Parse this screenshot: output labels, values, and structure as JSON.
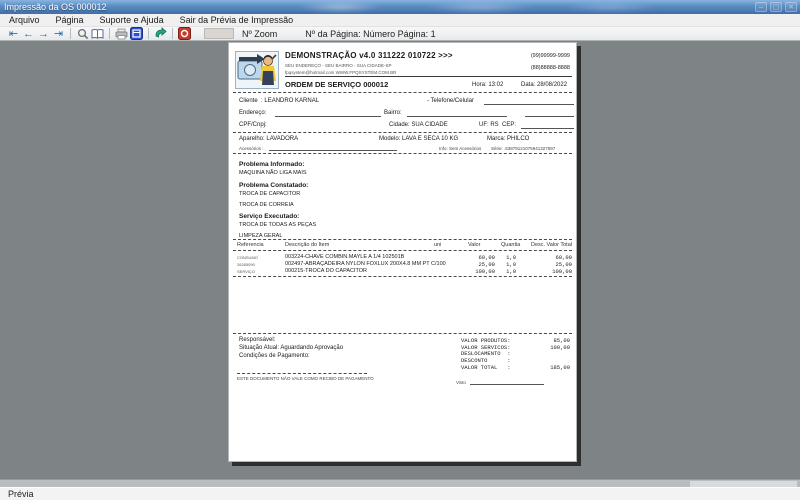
{
  "accents": {
    "titlebar_blue": "#4a7fb5",
    "workspace_gray": "#7e8486",
    "nav_arrow_blue": "#2f6bb3",
    "stop_red": "#c23b2e",
    "export_green": "#1f8a70",
    "setup_blue": "#2b4fd8"
  },
  "window": {
    "title": "Impressão da OS 000012",
    "controls": {
      "minimize": "–",
      "maximize": "▢",
      "close": "✕"
    }
  },
  "menu": {
    "items": [
      "Arquivo",
      "Página",
      "Suporte e Ajuda",
      "Sair da Prévia de Impressão"
    ]
  },
  "toolbar": {
    "nav": [
      {
        "name": "first-page",
        "glyph": "⇤"
      },
      {
        "name": "prev-page",
        "glyph": "←"
      },
      {
        "name": "next-page",
        "glyph": "→"
      },
      {
        "name": "last-page",
        "glyph": "⇥"
      }
    ],
    "icons": [
      "zoom-icon",
      "two-page-view-icon",
      "print-icon",
      "print-setup-icon",
      "export-icon",
      "close-preview-icon"
    ],
    "zoom_value": "",
    "zoom_label": "Nº Zoom",
    "page_label": "Nº da Página: Número Página: 1"
  },
  "statusbar": {
    "text": "Prévia"
  },
  "document": {
    "header": {
      "company_name": "DEMONSTRAÇÃO v4.0 311222 010722 >>>",
      "address": "SEU ENDEREÇO - SEU BAIRRO - SUA CIDADE-SP",
      "contact": "fpqsystem@hotmail.com  WWW.FPQSYSTEM.COM.BR",
      "phone1": "(99)99999-9999",
      "phone2": "(88)88888-8888",
      "order_title": "ORDEM DE SERVIÇO 000012",
      "hora": "Hora: 13:02",
      "data": "Data: 28/08/2022"
    },
    "client": {
      "cliente_label": "Cliente  :",
      "cliente": "LEANDRO KARNAL",
      "telefone_label": "- Telefone/Celular",
      "endereco_label": "Endereço:",
      "bairro_label": "Bairro:",
      "cpf_label": "CPF/Cnpj:",
      "cidade": "Cidade: SUA CIDADE",
      "uf_cep": "UF: RS  CEP:",
      "aparelho": "Aparelho: LAVADORA",
      "modelo": "Modelo: LAVA E SECA 10 KG",
      "marca": "Marca: PHILCO",
      "acessorios_label": "Acessórios :",
      "info": "Info: Sem Acessórios",
      "serie": "Série: .53879121075941327597"
    },
    "sections": [
      {
        "title": "Problema Informado:",
        "lines": [
          "MAQUINA NÃO LIGA MAIS"
        ]
      },
      {
        "title": "Problema Constatado:",
        "lines": [
          "TROCA DE CAPACITOR",
          "TROCA DE CORREIA"
        ]
      },
      {
        "title": "Serviço Executado:",
        "lines": [
          "TROCA DE TODAS AS PEÇAS",
          "LIMPEZA GERAL"
        ]
      }
    ],
    "items": {
      "headers": {
        "ref": "Referencia",
        "desc": "Descrição do Item",
        "uni": "uni",
        "valor": "Valor",
        "quantia": "Quantia",
        "desconto": "Desc.",
        "total": "Valor Total"
      },
      "rows": [
        {
          "ref": "CONSUMO",
          "desc": "003224-CHAVE COMBIN.MAYLE A 1/4 102501B",
          "valor": "60,00",
          "quantia": "1,0",
          "total": "60,00"
        },
        {
          "ref": "26265090",
          "desc": "002497-ABRAÇADEIRA NYLON FOXLUX 200X4.8 MM PT C/100",
          "valor": "25,00",
          "quantia": "1,0",
          "total": "25,00"
        },
        {
          "ref": "SERVIÇO",
          "desc": "000215-TROCA DO CAPACITOR",
          "valor": "100,00",
          "quantia": "1,0",
          "total": "100,00"
        }
      ]
    },
    "footer": {
      "responsavel": "Responsável:",
      "situacao": "Situação Atual: Aguardando Aprovação",
      "condicoes": "Condições de Pagamento:",
      "totals": [
        {
          "label": "VALOR PRODUTOS:",
          "value": "85,00"
        },
        {
          "label": "VALOR SERVICOS:",
          "value": "100,00"
        },
        {
          "label": "DESLOCAMENTO  :",
          "value": ""
        },
        {
          "label": "DESCONTO      :",
          "value": ""
        },
        {
          "label": "VALOR TOTAL   :",
          "value": "185,00"
        }
      ],
      "disclaimer": "ESTE DOCUMENTO NÃO VALE COMO RECIBO DE PAGAMENTO",
      "visto_label": "Visto"
    }
  }
}
